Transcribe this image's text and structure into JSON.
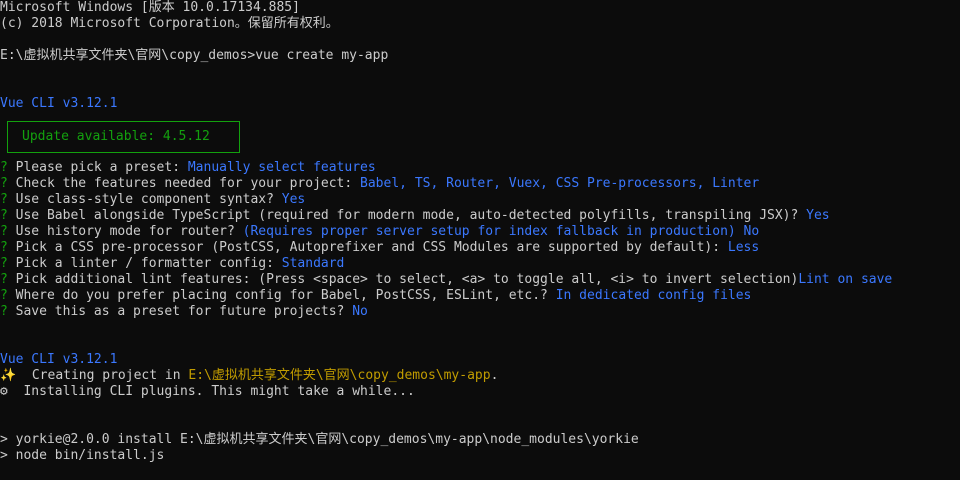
{
  "header": {
    "os_line": "Microsoft Windows [版本 10.0.17134.885]",
    "copyright_line": "(c) 2018 Microsoft Corporation。保留所有权利。"
  },
  "command": {
    "prompt": "E:\\虚拟机共享文件夹\\官网\\copy_demos>",
    "text": "vue create my-app"
  },
  "vue_cli": {
    "version_1": "Vue CLI v3.12.1",
    "update": "Update available: 4.5.12",
    "version_2": "Vue CLI v3.12.1"
  },
  "questions": [
    {
      "mark": "?",
      "q": " Please pick a preset: ",
      "a": "Manually select features"
    },
    {
      "mark": "?",
      "q": " Check the features needed for your project: ",
      "a": "Babel, TS, Router, Vuex, CSS Pre-processors, Linter"
    },
    {
      "mark": "?",
      "q": " Use class-style component syntax? ",
      "a": "Yes"
    },
    {
      "mark": "?",
      "q": " Use Babel alongside TypeScript (required for modern mode, auto-detected polyfills, transpiling JSX)? ",
      "a": "Yes"
    },
    {
      "mark": "?",
      "q": " Use history mode for router? ",
      "extra": "(Requires proper server setup for index fallback in production)",
      "a": " No"
    },
    {
      "mark": "?",
      "q": " Pick a CSS pre-processor (PostCSS, Autoprefixer and CSS Modules are supported by default): ",
      "a": "Less"
    },
    {
      "mark": "?",
      "q": " Pick a linter / formatter config: ",
      "a": "Standard"
    },
    {
      "mark": "?",
      "q": " Pick additional lint features: ",
      "extra": "(Press <space> to select, <a> to toggle all, <i> to invert selection)",
      "a": "Lint on save"
    },
    {
      "mark": "?",
      "q": " Where do you prefer placing config for Babel, PostCSS, ESLint, etc.? ",
      "a": "In dedicated config files"
    },
    {
      "mark": "?",
      "q": " Save this as a preset for future projects? ",
      "a": "No"
    }
  ],
  "progress": {
    "creating_icon": "✨",
    "creating_text": "  Creating project in ",
    "creating_path": "E:\\虚拟机共享文件夹\\官网\\copy_demos\\my-app",
    "creating_end": ".",
    "installing_icon": "⚙",
    "installing_text": "  Installing CLI plugins. This might take a while..."
  },
  "install": {
    "line1": "> yorkie@2.0.0 install E:\\虚拟机共享文件夹\\官网\\copy_demos\\my-app\\node_modules\\yorkie",
    "line2": "> node bin/install.js"
  }
}
